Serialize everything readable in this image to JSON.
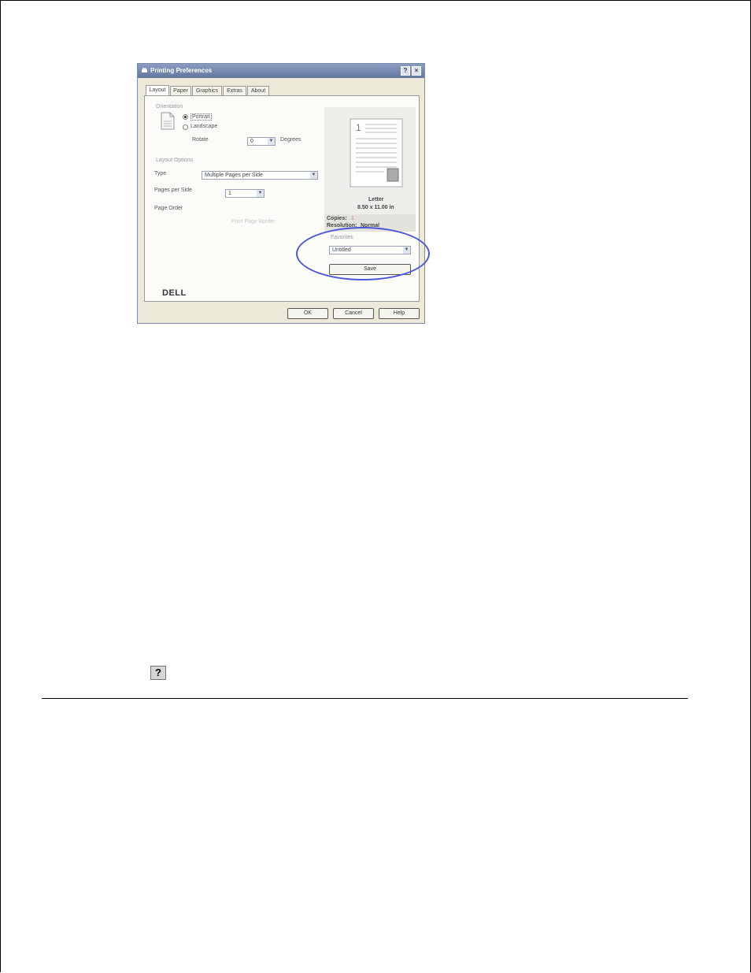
{
  "dialog": {
    "title": "Printing Preferences",
    "title_buttons": [
      "?",
      "×"
    ],
    "tabs": [
      "Layout",
      "Paper",
      "Graphics",
      "Extras",
      "About"
    ],
    "orientation": {
      "group_label": "Orientation",
      "portrait_label": "Portrait",
      "landscape_label": "Landscape",
      "rotate_label": "Rotate",
      "rotate_value": "0",
      "degrees_label": "Degrees"
    },
    "layout_options": {
      "group_label": "Layout Options",
      "type_label": "Type",
      "type_value": "Multiple Pages per Side",
      "pages_per_side_label": "Pages per Side",
      "pages_per_side_value": "1",
      "page_order_label": "Page Order",
      "disabled_button_label": "Print Page Border"
    },
    "preview": {
      "paper_name": "Letter",
      "paper_size": "8.50 x 11.00 in",
      "copies_label": "Copies:",
      "copies_value": "1",
      "resolution_label": "Resolution:",
      "resolution_value": "Normal"
    },
    "favorites": {
      "label": "Favorites",
      "value": "Untitled",
      "save_label": "Save"
    },
    "brand": "DELL",
    "buttons": {
      "ok": "OK",
      "cancel": "Cancel",
      "help": "Help"
    }
  },
  "help_icon": {
    "glyph": "?"
  },
  "colors": {
    "highlight_circle": "#4b56d9",
    "copies_value": "#d06ad0"
  }
}
